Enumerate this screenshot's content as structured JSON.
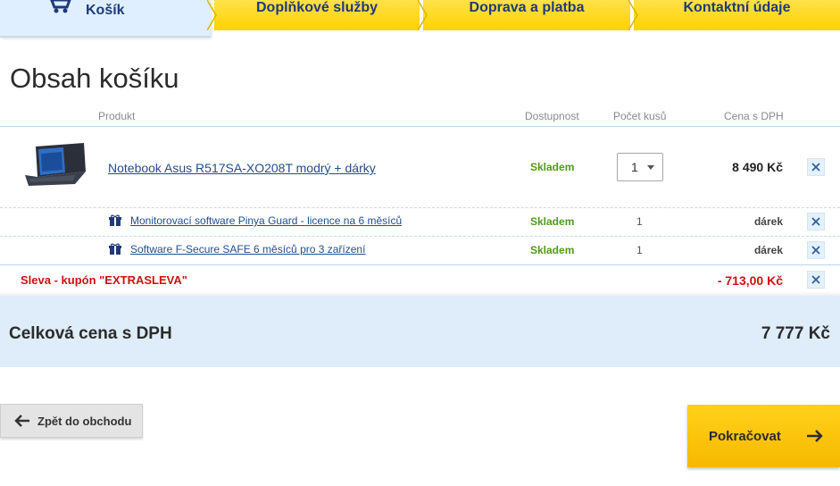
{
  "tabs": [
    {
      "label": "Košík",
      "active": true
    },
    {
      "label": "Doplňkové služby"
    },
    {
      "label": "Doprava a platba"
    },
    {
      "label": "Kontaktní údaje"
    }
  ],
  "page_title": "Obsah košíku",
  "columns": {
    "product": "Produkt",
    "availability": "Dostupnost",
    "quantity": "Počet kusů",
    "price": "Cena s DPH"
  },
  "item": {
    "name": "Notebook Asus R517SA-XO208T modrý + dárky",
    "availability": "Skladem",
    "quantity": "1",
    "price": "8 490 Kč"
  },
  "gifts": [
    {
      "name": "Monitorovací software Pinya Guard - licence na 6 měsíců",
      "availability": "Skladem",
      "quantity": "1",
      "price": "dárek"
    },
    {
      "name": "Software F-Secure SAFE 6 měsíců pro 3 zařízení",
      "availability": "Skladem",
      "quantity": "1",
      "price": "dárek"
    }
  ],
  "discount": {
    "label": "Sleva - kupón \"EXTRASLEVA\"",
    "value": "- 713,00 Kč"
  },
  "total": {
    "label": "Celková cena s DPH",
    "value": "7 777 Kč"
  },
  "buttons": {
    "back": "Zpět do obchodu",
    "next": "Pokračovat"
  },
  "colors": {
    "accent_yellow": "#ffd200",
    "link_blue": "#1e4f8e",
    "stock_green": "#4f9a1a",
    "discount_red": "#cc1111",
    "total_bg": "#deedf9"
  }
}
